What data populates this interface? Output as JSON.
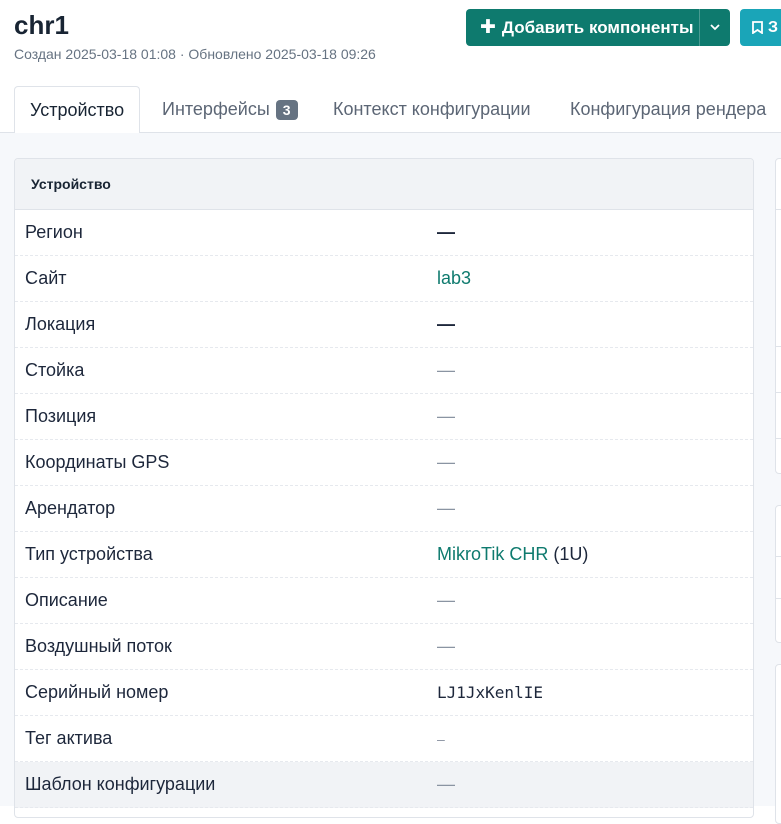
{
  "header": {
    "title": "chr1",
    "meta": "Создан 2025-03-18 01:08 · Обновлено 2025-03-18 09:26"
  },
  "actions": {
    "add_components_label": "Добавить компоненты",
    "add_icon": "plus-icon",
    "dropdown_icon": "chevron-down-icon",
    "bookmark_label": "З",
    "bookmark_icon": "bookmark-icon"
  },
  "tabs": [
    {
      "label": "Устройство",
      "active": true
    },
    {
      "label": "Интерфейсы",
      "badge": "3"
    },
    {
      "label": "Контекст конфигурации"
    },
    {
      "label": "Конфигурация рендера"
    }
  ],
  "device_card": {
    "header": "Устройство",
    "rows": [
      {
        "label": "Регион",
        "value": "—"
      },
      {
        "label": "Сайт",
        "value": "lab3"
      },
      {
        "label": "Локация",
        "value": "—"
      },
      {
        "label": "Стойка",
        "value": "—"
      },
      {
        "label": "Позиция",
        "value": "—"
      },
      {
        "label": "Координаты GPS",
        "value": "—"
      },
      {
        "label": "Арендатор",
        "value": "—"
      },
      {
        "label": "Тип устройства",
        "value": "MikroTik CHR",
        "value_suffix": "(1U)"
      },
      {
        "label": "Описание",
        "value": "—"
      },
      {
        "label": "Воздушный поток",
        "value": "—"
      },
      {
        "label": "Серийный номер",
        "value": "LJ1JxKenlIE"
      },
      {
        "label": "Тег актива",
        "value": "–"
      },
      {
        "label": "Шаблон конфигурации",
        "value": "—"
      }
    ]
  },
  "colors": {
    "primary": "#0e7a6e",
    "secondary": "#1aa5b8",
    "link": "#0e7a6e"
  }
}
